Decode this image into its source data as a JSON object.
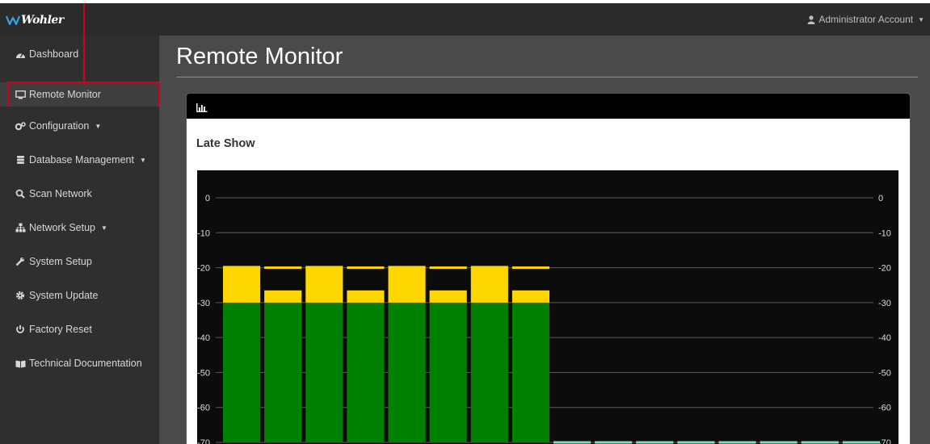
{
  "header": {
    "brand": "Wohler",
    "account_label": "Administrator Account"
  },
  "sidebar": {
    "items": [
      {
        "label": "Dashboard",
        "icon": "dashboard-icon"
      },
      {
        "label": "Remote Monitor",
        "icon": "monitor-icon"
      },
      {
        "label": "Configuration",
        "icon": "cogs-icon",
        "dropdown": true
      },
      {
        "label": "Database Management",
        "icon": "database-icon",
        "dropdown": true
      },
      {
        "label": "Scan Network",
        "icon": "search-icon"
      },
      {
        "label": "Network Setup",
        "icon": "sitemap-icon",
        "dropdown": true
      },
      {
        "label": "System Setup",
        "icon": "wrench-icon"
      },
      {
        "label": "System Update",
        "icon": "gear-icon"
      },
      {
        "label": "Factory Reset",
        "icon": "power-icon"
      },
      {
        "label": "Technical Documentation",
        "icon": "book-icon"
      }
    ]
  },
  "main": {
    "title": "Remote Monitor",
    "panel": {
      "header_icon": "bar-chart-icon",
      "subtitle": "Late Show"
    }
  },
  "colors": {
    "green": "#008000",
    "yellow": "#ffd700",
    "peak": "#ffd700",
    "idle": "#7fdcc0",
    "annotation": "#d0021b"
  },
  "chart_data": {
    "type": "bar",
    "title": "",
    "ylim": [
      -70,
      0
    ],
    "ticks": [
      0,
      -10,
      -20,
      -30,
      -40,
      -50,
      -60,
      -70
    ],
    "tick_labels_left": [
      "0",
      "-10",
      "-20",
      "-30",
      "-40",
      "-50",
      "-60",
      "-70"
    ],
    "tick_labels_right": [
      "0",
      "-10",
      "-20",
      "-30",
      "-40",
      "-50",
      "-60",
      "-70"
    ],
    "green_max": -30,
    "channels": [
      {
        "level": -19.5,
        "peak": null
      },
      {
        "level": -26.5,
        "peak": -20
      },
      {
        "level": -19.5,
        "peak": null
      },
      {
        "level": -26.5,
        "peak": -20
      },
      {
        "level": -19.5,
        "peak": null
      },
      {
        "level": -26.5,
        "peak": -20
      },
      {
        "level": -19.5,
        "peak": null
      },
      {
        "level": -26.5,
        "peak": -20
      },
      {
        "level": null,
        "peak": null
      },
      {
        "level": null,
        "peak": null
      },
      {
        "level": null,
        "peak": null
      },
      {
        "level": null,
        "peak": null
      },
      {
        "level": null,
        "peak": null
      },
      {
        "level": null,
        "peak": null
      },
      {
        "level": null,
        "peak": null
      },
      {
        "level": null,
        "peak": null
      }
    ]
  }
}
